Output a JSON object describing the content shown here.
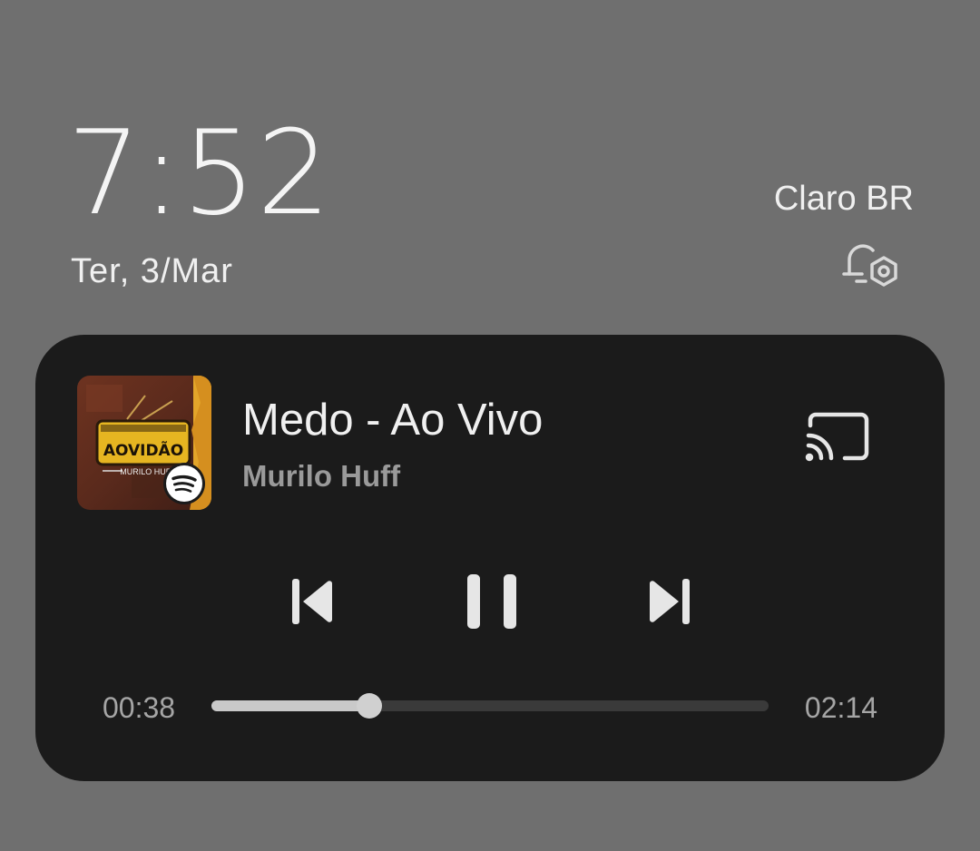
{
  "lockscreen": {
    "time": "7:52",
    "date": "Ter, 3/Mar",
    "carrier": "Claro BR",
    "alarm_icon": "bell-settings-icon"
  },
  "player": {
    "title": "Medo - Ao Vivo",
    "artist": "Murilo Huff",
    "album_art_text": "AOVIDÃO",
    "album_art_subtext": "MURILO HUFF",
    "source_app_icon": "spotify-icon",
    "cast_icon": "cast-icon",
    "controls": {
      "previous_icon": "skip-previous-icon",
      "pause_icon": "pause-icon",
      "next_icon": "skip-next-icon"
    },
    "elapsed": "00:38",
    "duration": "02:14",
    "progress": 0.2836
  },
  "colors": {
    "background": "#6f6f6f",
    "card": "#1b1b1b",
    "primary_text": "#f0f0f0",
    "secondary_text": "#9a9a9a",
    "progress_track": "#3a3a3a",
    "progress_fill": "#c9c9c9",
    "album_accent": "#e3a52a"
  }
}
